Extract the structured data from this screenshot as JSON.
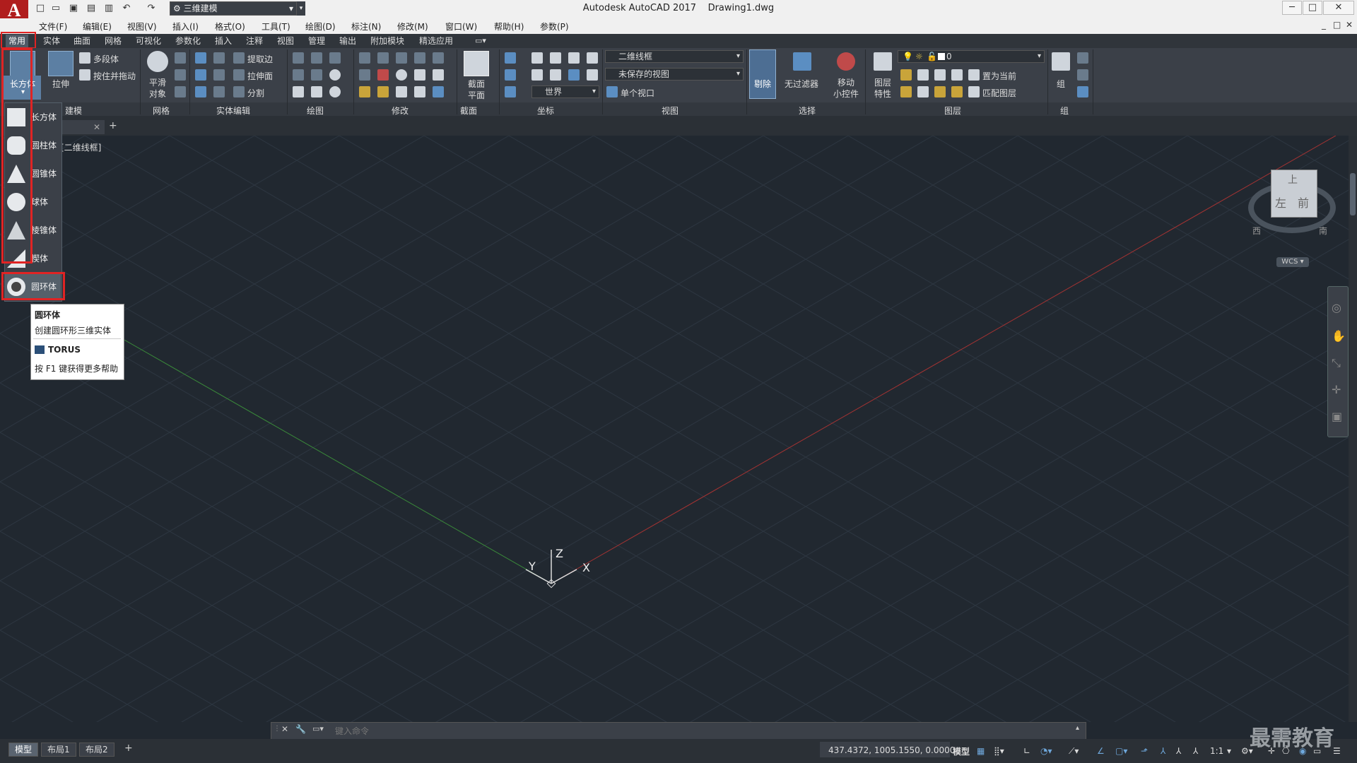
{
  "titlebar": {
    "app_title": "Autodesk AutoCAD 2017",
    "file_name": "Drawing1.dwg",
    "workspace": "三维建模",
    "minimize": "─",
    "restore": "□",
    "close": "✕"
  },
  "menubar": {
    "items": [
      "文件(F)",
      "编辑(E)",
      "视图(V)",
      "插入(I)",
      "格式(O)",
      "工具(T)",
      "绘图(D)",
      "标注(N)",
      "修改(M)",
      "窗口(W)",
      "帮助(H)",
      "参数(P)"
    ],
    "doc_controls": [
      "_",
      "□",
      "✕"
    ]
  },
  "ribbon_tabs": [
    "常用",
    "实体",
    "曲面",
    "网格",
    "可视化",
    "参数化",
    "插入",
    "注释",
    "视图",
    "管理",
    "输出",
    "附加模块",
    "精选应用"
  ],
  "ribbon": {
    "modeling": {
      "box": "长方体",
      "extrude": "拉伸",
      "polysolid": "多段体",
      "presspull": "按住并拖动",
      "panel": "建模"
    },
    "mesh": {
      "smooth": "平滑",
      "smooth2": "对象",
      "panel": "网格"
    },
    "solid_edit": {
      "extract_edges": "提取边",
      "extrude_faces": "拉伸面",
      "separate": "分割",
      "panel": "实体编辑"
    },
    "draw": {
      "panel": "绘图"
    },
    "modify": {
      "panel": "修改"
    },
    "section": {
      "plane": "截面",
      "plane2": "平面",
      "panel": "截面"
    },
    "coords": {
      "world": "世界",
      "panel": "坐标"
    },
    "view": {
      "visual_style": "二维线框",
      "saved_view": "未保存的视图",
      "viewport": "单个视口",
      "panel": "视图"
    },
    "selection": {
      "culling": "剔除",
      "no_filter": "无过滤器",
      "gizmo": "移动",
      "gizmo2": "小控件",
      "panel": "选择"
    },
    "layers": {
      "layer_props": "图层",
      "layer_props2": "特性",
      "current_layer": "0",
      "make_current": "置为当前",
      "match_layer": "匹配图层",
      "panel": "图层"
    },
    "groups": {
      "group": "组",
      "panel": "组"
    }
  },
  "viewport": {
    "label": "[二维线框]",
    "ucs": {
      "x": "X",
      "y": "Y",
      "z": "Z"
    },
    "viewcube": {
      "top": "上",
      "left": "左",
      "front": "前",
      "west": "西",
      "south": "南",
      "wcs": "WCS"
    }
  },
  "dropdown": {
    "items": [
      "长方体",
      "圆柱体",
      "圆锥体",
      "球体",
      "棱锥体",
      "楔体",
      "圆环体"
    ]
  },
  "tooltip": {
    "title": "圆环体",
    "desc": "创建圆环形三维实体",
    "command": "TORUS",
    "help": "按 F1 键获得更多帮助"
  },
  "commandline": {
    "placeholder": "键入命令"
  },
  "layout_tabs": [
    "模型",
    "布局1",
    "布局2"
  ],
  "statusbar": {
    "coords": "437.4372, 1005.1550, 0.0000",
    "model": "模型",
    "scale": "1:1"
  },
  "watermark": "最需教育"
}
